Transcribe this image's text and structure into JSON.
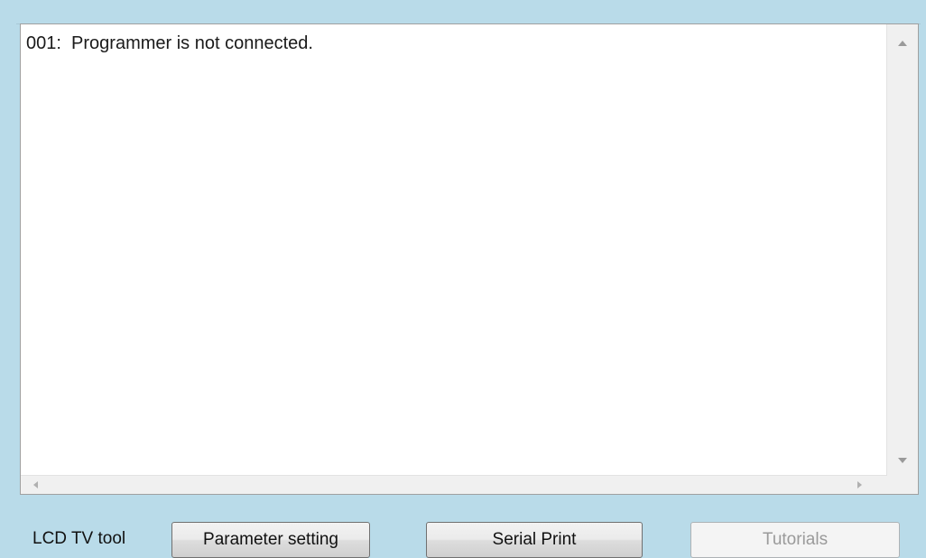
{
  "log": {
    "lines": [
      "001:  Programmer is not connected."
    ]
  },
  "toolbar": {
    "label": "LCD TV tool",
    "parameter_setting": "Parameter setting",
    "serial_print": "Serial Print",
    "tutorials": "Tutorials",
    "tutorials_enabled": false
  },
  "colors": {
    "background": "#b9dbe9",
    "panel": "#ffffff",
    "disabled_text": "#9a9a9a"
  }
}
